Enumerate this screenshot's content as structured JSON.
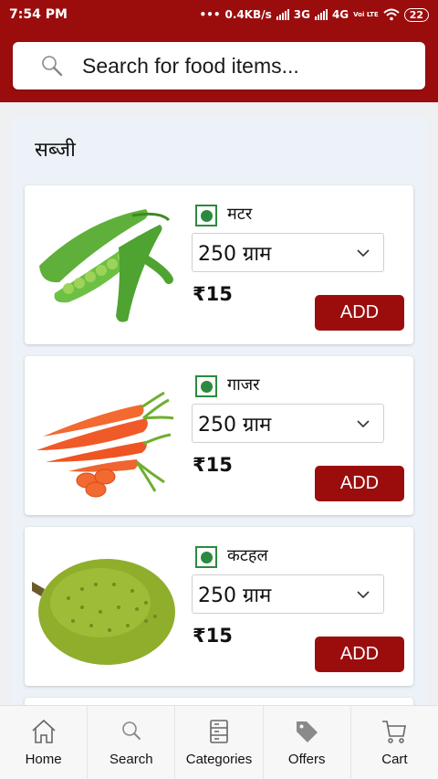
{
  "status_bar": {
    "time": "7:54 PM",
    "network_speed": "0.4KB/s",
    "network_1": "3G",
    "network_2": "4G",
    "volte": "Voi LTE",
    "battery": "22"
  },
  "search": {
    "placeholder": "Search for food items..."
  },
  "section": {
    "title": "सब्जी"
  },
  "products": [
    {
      "name": "मटर",
      "quantity": "250 ग्राम",
      "price": "₹15",
      "add_label": "ADD",
      "veg": true
    },
    {
      "name": "गाजर",
      "quantity": "250 ग्राम",
      "price": "₹15",
      "add_label": "ADD",
      "veg": true
    },
    {
      "name": "कटहल",
      "quantity": "250 ग्राम",
      "price": "₹15",
      "add_label": "ADD",
      "veg": true
    }
  ],
  "bottom_nav": [
    {
      "label": "Home",
      "icon": "home-icon"
    },
    {
      "label": "Search",
      "icon": "search-icon"
    },
    {
      "label": "Categories",
      "icon": "categories-icon"
    },
    {
      "label": "Offers",
      "icon": "tag-icon"
    },
    {
      "label": "Cart",
      "icon": "cart-icon"
    }
  ],
  "colors": {
    "brand": "#9b0d0d",
    "veg_green": "#2b8a3e"
  }
}
